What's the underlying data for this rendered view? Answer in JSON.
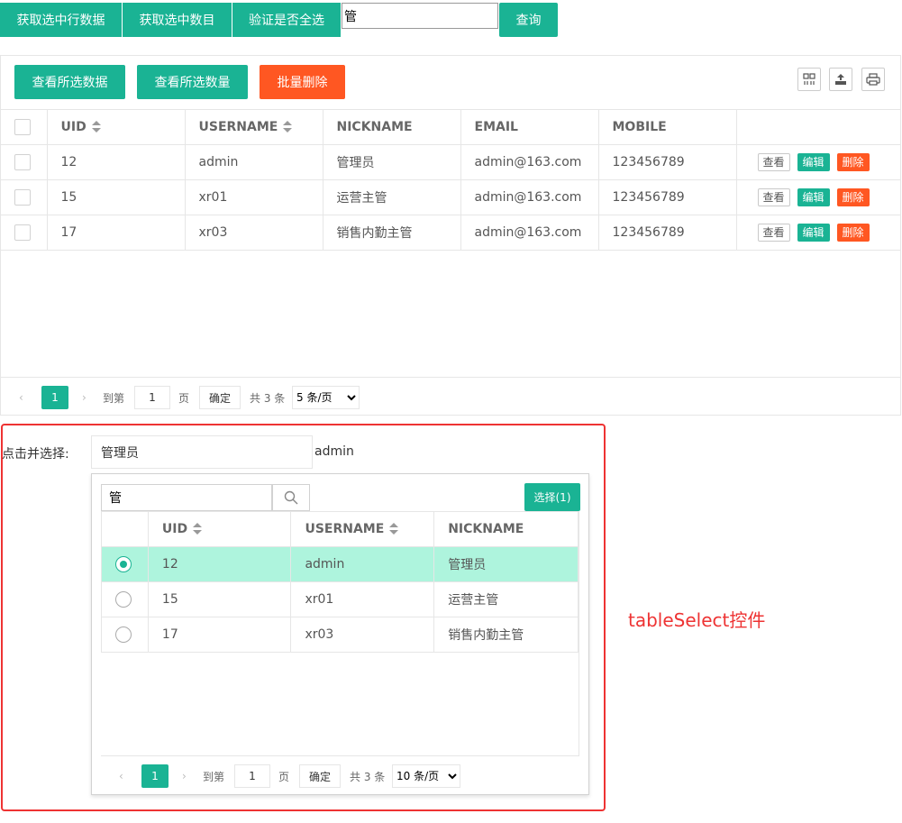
{
  "toolbar": {
    "get_selected_rows": "获取选中行数据",
    "get_selected_count": "获取选中数目",
    "check_all_selected": "验证是否全选",
    "search_value": "管",
    "query_label": "查询"
  },
  "grid": {
    "btn_view_selected": "查看所选数据",
    "btn_count_selected": "查看所选数量",
    "btn_batch_delete": "批量删除",
    "icons": [
      "columns-filter-icon",
      "export-icon",
      "print-icon"
    ],
    "columns": [
      "UID",
      "USERNAME",
      "NICKNAME",
      "EMAIL",
      "MOBILE"
    ],
    "rows": [
      {
        "uid": "12",
        "username": "admin",
        "nickname": "管理员",
        "email": "admin@163.com",
        "mobile": "123456789"
      },
      {
        "uid": "15",
        "username": "xr01",
        "nickname": "运营主管",
        "email": "admin@163.com",
        "mobile": "123456789"
      },
      {
        "uid": "17",
        "username": "xr03",
        "nickname": "销售内勤主管",
        "email": "admin@163.com",
        "mobile": "123456789"
      }
    ],
    "row_actions": {
      "view": "查看",
      "edit": "编辑",
      "delete": "删除"
    },
    "pager": {
      "current_page": "1",
      "goto_prefix": "到第",
      "goto_value": "1",
      "goto_suffix": "页",
      "confirm": "确定",
      "total": "共 3 条",
      "page_size": "5 条/页"
    }
  },
  "table_select": {
    "label": "点击并选择:",
    "input_value": "管理员",
    "selected_value": "admin",
    "search_value": "管",
    "choose_button": "选择(1)",
    "columns": [
      "UID",
      "USERNAME",
      "NICKNAME"
    ],
    "rows": [
      {
        "uid": "12",
        "username": "admin",
        "nickname": "管理员",
        "selected": true
      },
      {
        "uid": "15",
        "username": "xr01",
        "nickname": "运营主管",
        "selected": false
      },
      {
        "uid": "17",
        "username": "xr03",
        "nickname": "销售内勤主管",
        "selected": false
      }
    ],
    "pager": {
      "current_page": "1",
      "goto_prefix": "到第",
      "goto_value": "1",
      "goto_suffix": "页",
      "confirm": "确定",
      "total": "共 3 条",
      "page_size": "10 条/页"
    }
  },
  "annotation": "tableSelect控件",
  "colors": {
    "accent": "#1ab394",
    "danger": "#ff5722",
    "highlight": "#aef4dd",
    "annotation": "#ee3333"
  }
}
